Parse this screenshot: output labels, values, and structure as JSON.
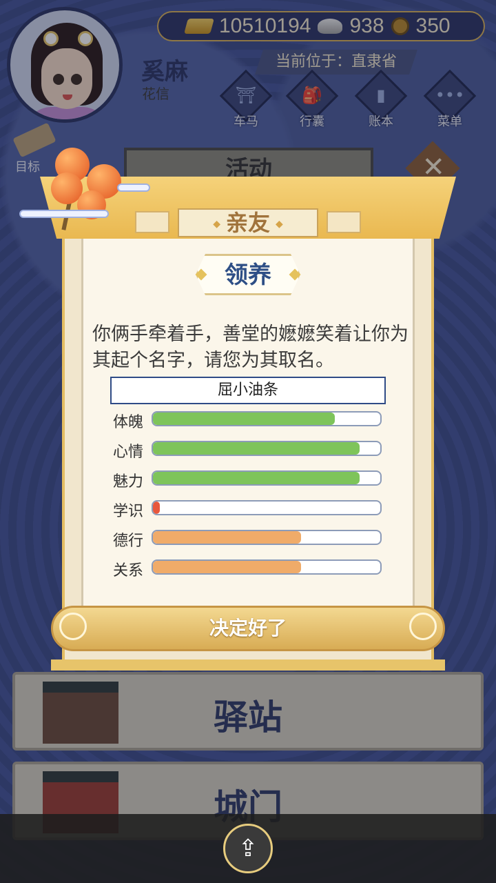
{
  "player": {
    "name": "奚麻",
    "title": "花信",
    "location": "当前位于：直隶省"
  },
  "currency": {
    "gold": "10510194",
    "silver": "938",
    "coins": "350"
  },
  "top_buttons": [
    {
      "label": "车马",
      "icon": "carriage-icon"
    },
    {
      "label": "行囊",
      "icon": "bag-icon"
    },
    {
      "label": "账本",
      "icon": "ledger-icon"
    },
    {
      "label": "菜单",
      "icon": "more-icon"
    }
  ],
  "goal_label": "目标",
  "activity_banner": "活动",
  "background_rows": [
    {
      "title": "驿站"
    },
    {
      "title": "城门"
    }
  ],
  "dialog": {
    "category": "亲友",
    "heading": "领养",
    "story": "你俩手牵着手，善堂的嬷嬷笑着让你为其起个名字，请您为其取名。",
    "name_value": "屈小油条",
    "stats": [
      {
        "label": "体魄",
        "level": 0.8,
        "color": "#7ec45a"
      },
      {
        "label": "心情",
        "level": 0.91,
        "color": "#7ec45a"
      },
      {
        "label": "魅力",
        "level": 0.91,
        "color": "#7ec45a"
      },
      {
        "label": "学识",
        "level": 0.03,
        "color": "#e8573c"
      },
      {
        "label": "德行",
        "level": 0.65,
        "color": "#f0ab69"
      },
      {
        "label": "关系",
        "level": 0.65,
        "color": "#f0ab69"
      }
    ],
    "confirm_label": "决定好了"
  }
}
